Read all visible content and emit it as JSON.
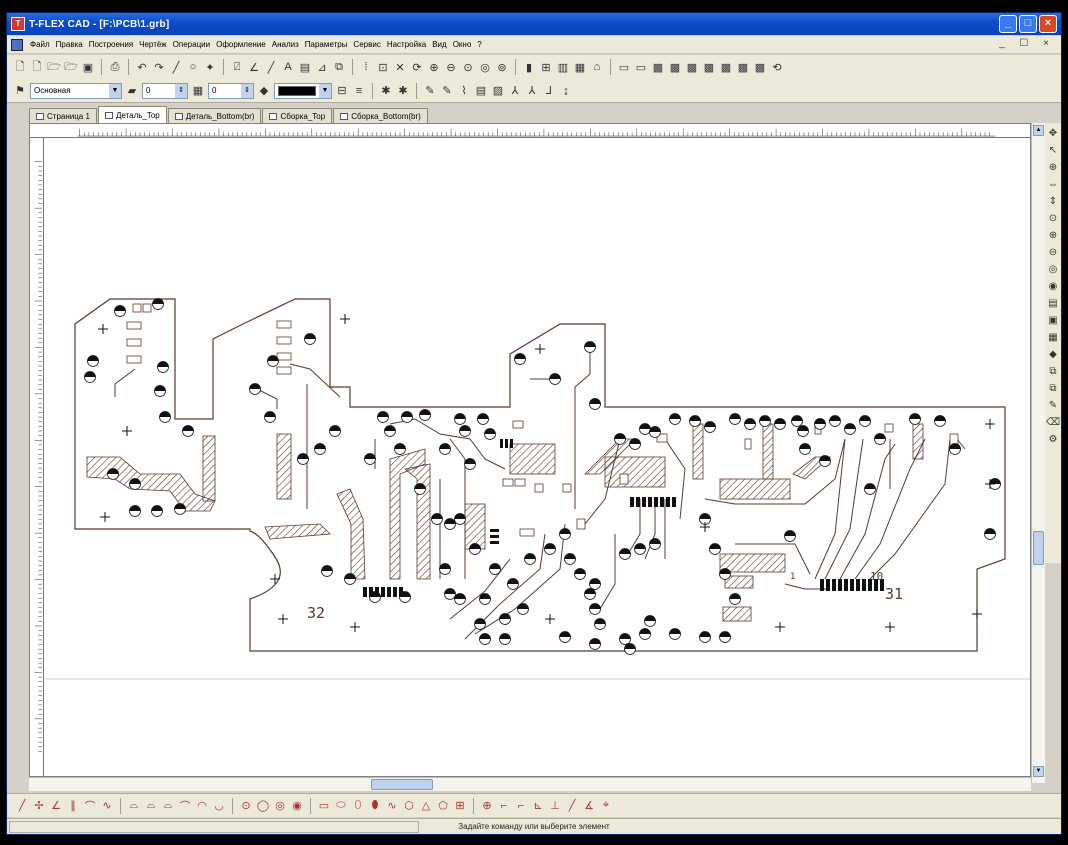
{
  "window": {
    "title": "T-FLEX CAD - [F:\\PCB\\1.grb]",
    "minimize_glyph": "_",
    "maximize_glyph": "□",
    "close_glyph": "×",
    "mdi_controls": "_ ☐ ×"
  },
  "menu": {
    "items": [
      "Файл",
      "Правка",
      "Построения",
      "Чертёж",
      "Операции",
      "Оформление",
      "Анализ",
      "Параметры",
      "Сервис",
      "Настройка",
      "Вид",
      "Окно",
      "?"
    ]
  },
  "toolbar2": {
    "layer_value": "Основная",
    "level_value": "0",
    "style_value": "0",
    "color_name": "black"
  },
  "tabs": [
    {
      "label": "Страница 1",
      "active": false
    },
    {
      "label": "Деталь_Top",
      "active": true
    },
    {
      "label": "Деталь_Bottom(br)",
      "active": false
    },
    {
      "label": "Сборка_Top",
      "active": false
    },
    {
      "label": "Сборка_Bottom(br)",
      "active": false
    }
  ],
  "drawing": {
    "labels": {
      "ref_left": "32",
      "ref_right": "31",
      "ref_top": "10",
      "ref_small": "1"
    }
  },
  "status": {
    "text": "Задайте команду или выберите элемент"
  },
  "colors": {
    "titlebar": "#0a4fcf",
    "chrome": "#ece9d8",
    "pcb_line": "#5a3a2a",
    "accent_close": "#d9481f"
  }
}
